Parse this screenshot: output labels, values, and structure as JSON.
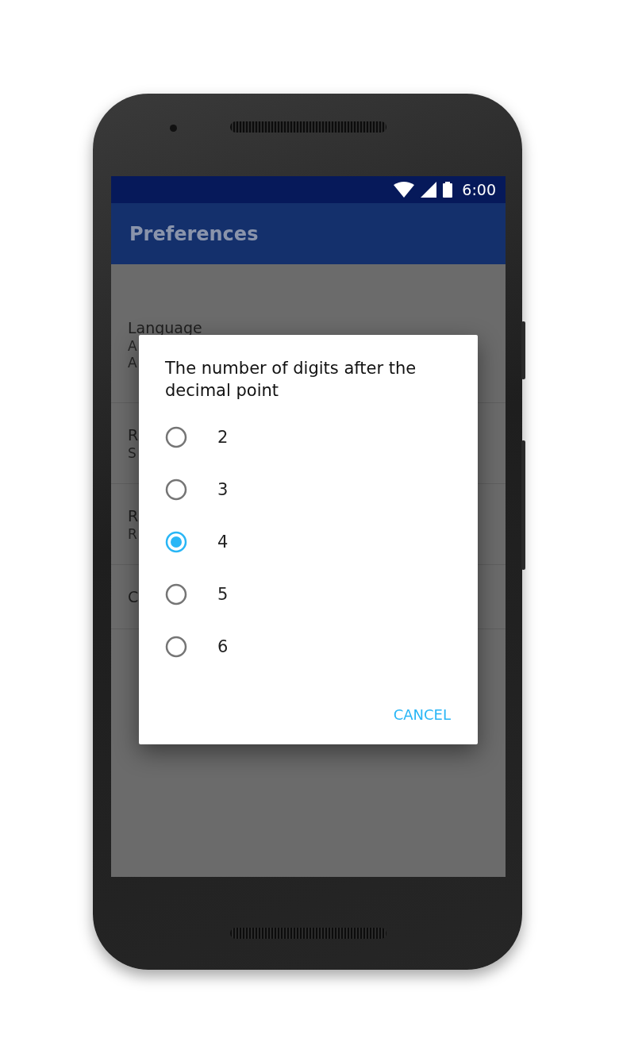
{
  "status_bar": {
    "time": "6:00"
  },
  "toolbar": {
    "title": "Preferences"
  },
  "preferences": [
    {
      "title": "Language",
      "summary": [
        "A",
        "A"
      ]
    },
    {
      "title": "R",
      "summary": [
        "S"
      ]
    },
    {
      "title": "R",
      "summary": [
        "R"
      ]
    },
    {
      "title": "C"
    }
  ],
  "dialog": {
    "title": "The number of digits after the decimal point",
    "options": [
      {
        "label": "2",
        "selected": false
      },
      {
        "label": "3",
        "selected": false
      },
      {
        "label": "4",
        "selected": true
      },
      {
        "label": "5",
        "selected": false
      },
      {
        "label": "6",
        "selected": false
      }
    ],
    "buttons": [
      {
        "label": "CANCEL"
      }
    ]
  }
}
